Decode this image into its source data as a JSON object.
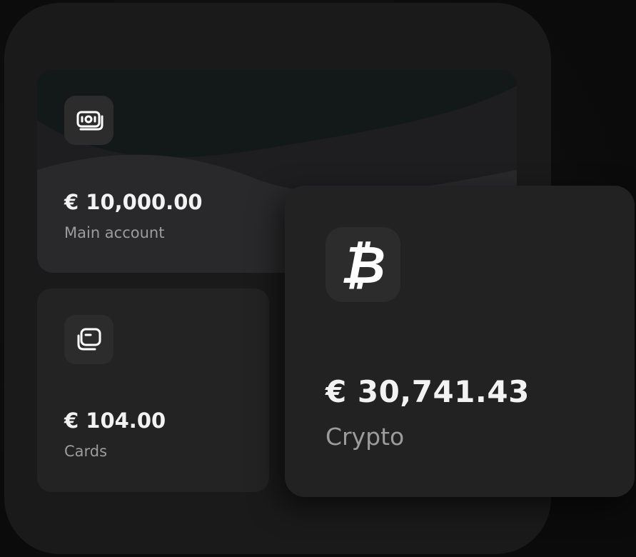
{
  "accounts": {
    "main": {
      "amount": "€ 10,000.00",
      "label": "Main account",
      "icon": "banknotes-icon"
    },
    "cards": {
      "amount": "€ 104.00",
      "label": "Cards",
      "icon": "cards-icon"
    },
    "crypto": {
      "amount": "€ 30,741.43",
      "label": "Crypto",
      "icon": "bitcoin-icon",
      "glyph": "₿"
    }
  },
  "colors": {
    "background": "#0b0b0b",
    "frame": "#1a1a1a",
    "card": "#232323",
    "card_main": "#131918",
    "icon_tile": "#2c2c2c",
    "text_primary": "#f2f2f2",
    "text_secondary": "#9c9c9c"
  }
}
